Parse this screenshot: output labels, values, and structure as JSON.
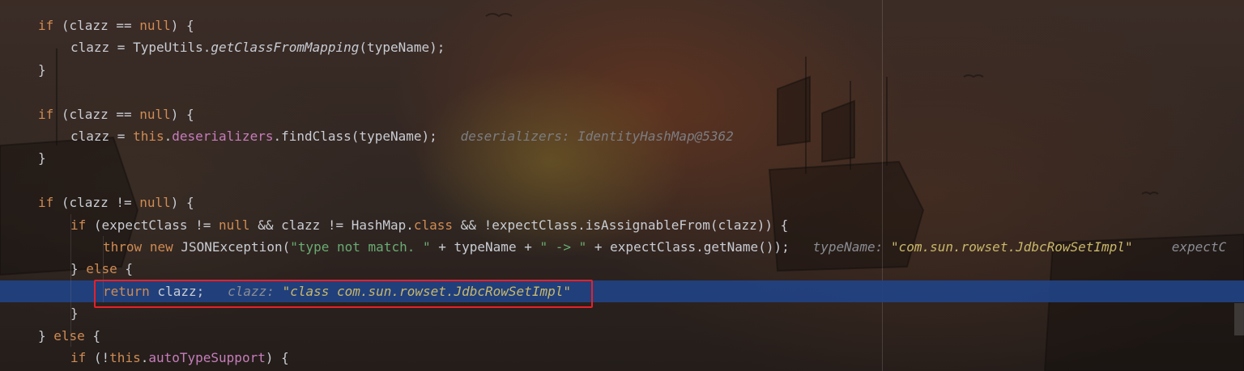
{
  "editor": {
    "lines": [
      {
        "indent": 0,
        "tokens": [
          {
            "t": "if",
            "c": "kw"
          },
          {
            "t": " (clazz == "
          },
          {
            "t": "null",
            "c": "kw"
          },
          {
            "t": ") {"
          }
        ]
      },
      {
        "indent": 1,
        "tokens": [
          {
            "t": "clazz = TypeUtils."
          },
          {
            "t": "getClassFromMapping",
            "c": "it"
          },
          {
            "t": "(typeName);"
          }
        ]
      },
      {
        "indent": 0,
        "tokens": [
          {
            "t": "}"
          }
        ]
      },
      {
        "indent": 0,
        "tokens": []
      },
      {
        "indent": 0,
        "tokens": [
          {
            "t": "if",
            "c": "kw"
          },
          {
            "t": " (clazz == "
          },
          {
            "t": "null",
            "c": "kw"
          },
          {
            "t": ") {"
          }
        ]
      },
      {
        "indent": 1,
        "tokens": [
          {
            "t": "clazz = "
          },
          {
            "t": "this",
            "c": "kw"
          },
          {
            "t": "."
          },
          {
            "t": "deserializers",
            "c": "fld"
          },
          {
            "t": ".findClass(typeName);"
          },
          {
            "t": "   deserializers: IdentityHashMap@5362",
            "c": "hint"
          }
        ]
      },
      {
        "indent": 0,
        "tokens": [
          {
            "t": "}"
          }
        ]
      },
      {
        "indent": 0,
        "tokens": []
      },
      {
        "indent": 0,
        "tokens": [
          {
            "t": "if",
            "c": "kw"
          },
          {
            "t": " (clazz != "
          },
          {
            "t": "null",
            "c": "kw"
          },
          {
            "t": ") {"
          }
        ]
      },
      {
        "indent": 1,
        "tokens": [
          {
            "t": "if",
            "c": "kw"
          },
          {
            "t": " (expectClass != "
          },
          {
            "t": "null",
            "c": "kw"
          },
          {
            "t": " && clazz != HashMap."
          },
          {
            "t": "class",
            "c": "kw"
          },
          {
            "t": " && !expectClass.isAssignableFrom(clazz)) {"
          }
        ]
      },
      {
        "indent": 2,
        "tokens": [
          {
            "t": "throw",
            "c": "kw"
          },
          {
            "t": " "
          },
          {
            "t": "new",
            "c": "kw"
          },
          {
            "t": " JSONException("
          },
          {
            "t": "\"type not match. \"",
            "c": "str"
          },
          {
            "t": " + typeName + "
          },
          {
            "t": "\" -> \"",
            "c": "str"
          },
          {
            "t": " + expectClass.getName());"
          },
          {
            "t": "   typeName: ",
            "c": "hint-name"
          },
          {
            "t": "\"com.sun.rowset.JdbcRowSetImpl\"",
            "c": "hint-val"
          },
          {
            "t": "     expectC",
            "c": "hint-name"
          }
        ]
      },
      {
        "indent": 1,
        "tokens": [
          {
            "t": "} "
          },
          {
            "t": "else",
            "c": "kw"
          },
          {
            "t": " {"
          }
        ]
      },
      {
        "indent": 2,
        "exec": true,
        "tokens": [
          {
            "t": "return",
            "c": "kw"
          },
          {
            "t": " clazz;"
          },
          {
            "t": "   clazz: ",
            "c": "hint-name"
          },
          {
            "t": "\"class com.sun.rowset.JdbcRowSetImpl\"",
            "c": "hint-val"
          }
        ]
      },
      {
        "indent": 1,
        "tokens": [
          {
            "t": "}"
          }
        ]
      },
      {
        "indent": 0,
        "tokens": [
          {
            "t": "} "
          },
          {
            "t": "else",
            "c": "kw"
          },
          {
            "t": " {"
          }
        ]
      },
      {
        "indent": 1,
        "tokens": [
          {
            "t": "if",
            "c": "kw"
          },
          {
            "t": " (!"
          },
          {
            "t": "this",
            "c": "kw"
          },
          {
            "t": "."
          },
          {
            "t": "autoTypeSupport",
            "c": "fld"
          },
          {
            "t": ") {"
          }
        ]
      }
    ]
  }
}
